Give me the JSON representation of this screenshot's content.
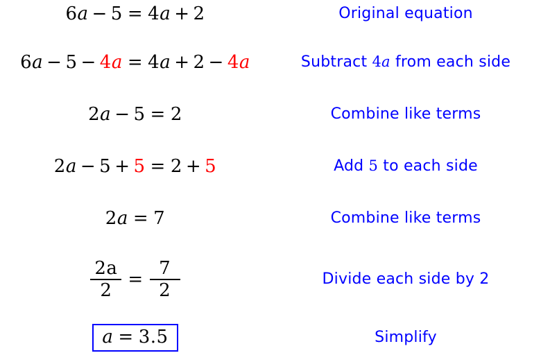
{
  "document": {
    "kind": "algebra-solution-steps",
    "background_color": "#ffffff",
    "math_color": "#000000",
    "highlight_color": "#ff0000",
    "description_color": "#0000ff",
    "box_border_color": "#0000ff"
  },
  "steps": [
    {
      "id": "step-1",
      "equation": {
        "plain": "6a - 5 = 4a + 2",
        "lhs": [
          {
            "text": "6",
            "style": "num"
          },
          {
            "text": "a",
            "style": "var"
          },
          {
            "text": "−",
            "style": "op"
          },
          {
            "text": "5",
            "style": "num"
          }
        ],
        "rhs": [
          {
            "text": "4",
            "style": "num"
          },
          {
            "text": "a",
            "style": "var"
          },
          {
            "text": "+",
            "style": "op"
          },
          {
            "text": "2",
            "style": "num"
          }
        ]
      },
      "description": "Original equation"
    },
    {
      "id": "step-2",
      "equation": {
        "plain": "6a - 5 - 4a = 4a + 2 - 4a",
        "lhs": [
          {
            "text": "6",
            "style": "num"
          },
          {
            "text": "a",
            "style": "var"
          },
          {
            "text": "−",
            "style": "op"
          },
          {
            "text": "5",
            "style": "num"
          },
          {
            "text": "−",
            "style": "op"
          },
          {
            "text": "4",
            "style": "num-hl"
          },
          {
            "text": "a",
            "style": "var-hl"
          }
        ],
        "rhs": [
          {
            "text": "4",
            "style": "num"
          },
          {
            "text": "a",
            "style": "var"
          },
          {
            "text": "+",
            "style": "op"
          },
          {
            "text": "2",
            "style": "num"
          },
          {
            "text": "−",
            "style": "op"
          },
          {
            "text": "4",
            "style": "num-hl"
          },
          {
            "text": "a",
            "style": "var-hl"
          }
        ]
      },
      "description_parts": [
        {
          "text": "Subtract ",
          "style": "text"
        },
        {
          "text": "4",
          "style": "mnum"
        },
        {
          "text": "a",
          "style": "mvar"
        },
        {
          "text": " from each side",
          "style": "text"
        }
      ],
      "description": "Subtract 4a from each side"
    },
    {
      "id": "step-3",
      "equation": {
        "plain": "2a - 5 = 2",
        "lhs": [
          {
            "text": "2",
            "style": "num"
          },
          {
            "text": "a",
            "style": "var"
          },
          {
            "text": "−",
            "style": "op"
          },
          {
            "text": "5",
            "style": "num"
          }
        ],
        "rhs": [
          {
            "text": "2",
            "style": "num"
          }
        ]
      },
      "description": "Combine like terms"
    },
    {
      "id": "step-4",
      "equation": {
        "plain": "2a - 5 + 5 = 2 + 5",
        "lhs": [
          {
            "text": "2",
            "style": "num"
          },
          {
            "text": "a",
            "style": "var"
          },
          {
            "text": "−",
            "style": "op"
          },
          {
            "text": "5",
            "style": "num"
          },
          {
            "text": "+",
            "style": "op"
          },
          {
            "text": "5",
            "style": "num-hl"
          }
        ],
        "rhs": [
          {
            "text": "2",
            "style": "num"
          },
          {
            "text": "+",
            "style": "op"
          },
          {
            "text": "5",
            "style": "num-hl"
          }
        ]
      },
      "description_parts": [
        {
          "text": "Add ",
          "style": "text"
        },
        {
          "text": "5",
          "style": "mnum"
        },
        {
          "text": " to each side",
          "style": "text"
        }
      ],
      "description": "Add 5 to each side"
    },
    {
      "id": "step-5",
      "equation": {
        "plain": "2a = 7",
        "lhs": [
          {
            "text": "2",
            "style": "num"
          },
          {
            "text": "a",
            "style": "var"
          }
        ],
        "rhs": [
          {
            "text": "7",
            "style": "num"
          }
        ]
      },
      "description": "Combine like terms"
    },
    {
      "id": "step-6",
      "equation": {
        "plain": "2a/2 = 7/2",
        "fraction_left": {
          "numerator": "2a",
          "denominator": "2"
        },
        "fraction_right": {
          "numerator": "7",
          "denominator": "2"
        }
      },
      "description": "Divide each side by 2"
    },
    {
      "id": "step-7",
      "equation": {
        "plain": "a = 3.5",
        "boxed": true,
        "lhs": [
          {
            "text": "a",
            "style": "var"
          }
        ],
        "rhs": [
          {
            "text": "3.5",
            "style": "num"
          }
        ]
      },
      "description": "Simplify"
    }
  ],
  "symbols": {
    "equals": "=",
    "minus": "−",
    "plus": "+"
  }
}
